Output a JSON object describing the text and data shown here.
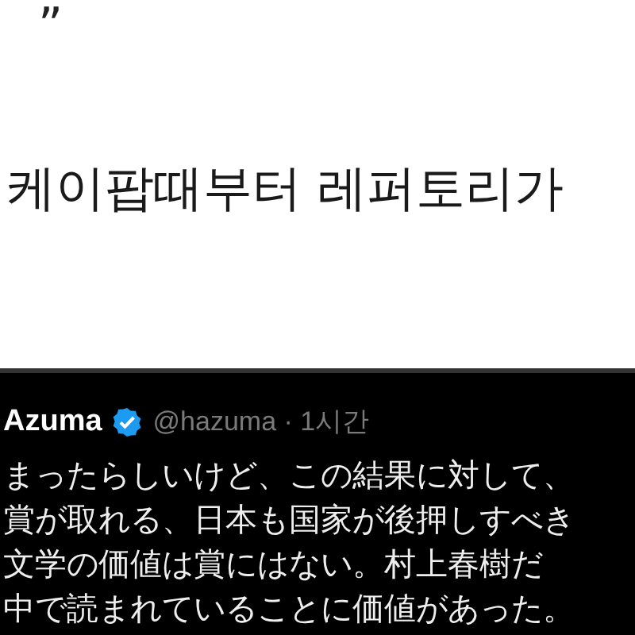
{
  "top_fragment": "”",
  "korean_line": "케이팝때부터 레퍼토리가",
  "quoted_tweet": {
    "name": "Azuma",
    "verified": true,
    "handle": "@hazuma · 1시간",
    "lines": [
      "まったらしいけど、この結果に対して、",
      "賞が取れる、日本も国家が後押しすべき",
      "文学の価値は賞にはない。村上春樹だ",
      "中で読まれていることに価値があった。"
    ]
  }
}
